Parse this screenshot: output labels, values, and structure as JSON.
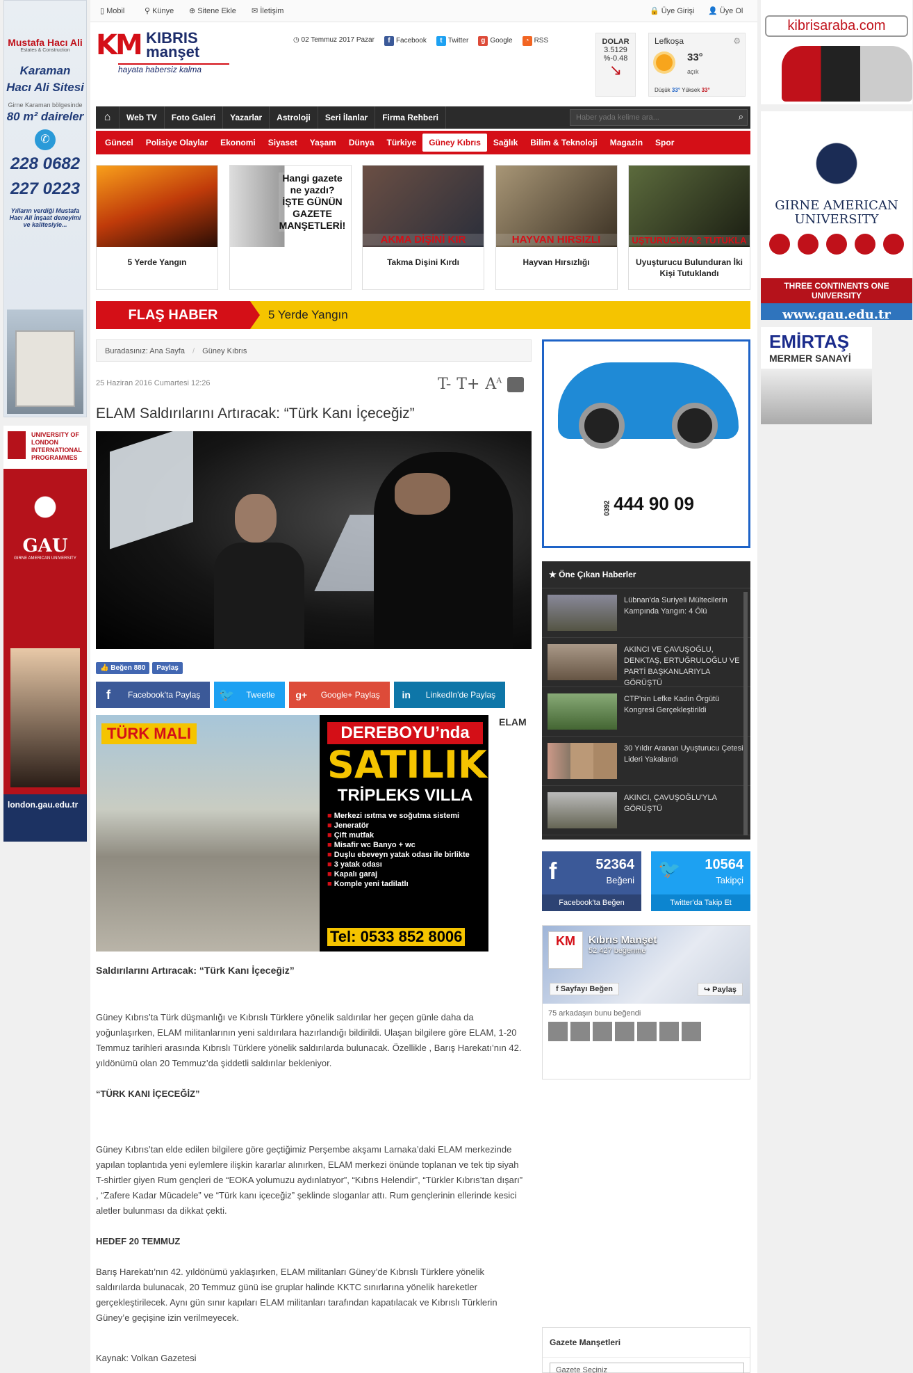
{
  "topbar": {
    "mobile": "Mobil",
    "kunye": "Künye",
    "add_site": "Sitene Ekle",
    "contact": "İletişim",
    "login": "Üye Girişi",
    "register": "Üye Ol"
  },
  "logo": {
    "km": "KM",
    "kibris": "KIBRIS",
    "manset": "manşet",
    "slogan": "hayata habersiz kalma"
  },
  "header": {
    "date": "02 Temmuz 2017 Pazar",
    "facebook": "Facebook",
    "twitter": "Twitter",
    "google": "Google",
    "rss": "RSS"
  },
  "dollar": {
    "label": "DOLAR",
    "value": "3.5129",
    "change": "%-0.48"
  },
  "weather": {
    "city": "Lefkoşa",
    "temp": "33°",
    "cond": "açık",
    "low_label": "Düşük",
    "low": "33°",
    "high_label": "Yüksek",
    "high": "33°"
  },
  "nav1": [
    "Web TV",
    "Foto Galeri",
    "Yazarlar",
    "Astroloji",
    "Seri İlanlar",
    "Firma Rehberi"
  ],
  "search_placeholder": "Haber yada kelime ara...",
  "nav2": [
    "Güncel",
    "Polisiye Olaylar",
    "Ekonomi",
    "Siyaset",
    "Yaşam",
    "Dünya",
    "Türkiye",
    "Güney Kıbrıs",
    "Sağlık",
    "Bilim & Teknoloji",
    "Magazin",
    "Spor"
  ],
  "cards": [
    {
      "title": "5 Yerde Yangın",
      "band": ""
    },
    {
      "title": "",
      "band": "Hangi gazete ne yazdı? İŞTE GÜNÜN GAZETE MANŞETLERİ!"
    },
    {
      "title": "Takma Dişini Kırdı",
      "band": "AKMA DİŞİNİ KIR"
    },
    {
      "title": "Hayvan Hırsızlığı",
      "band": "HAYVAN HIRSIZLI"
    },
    {
      "title": "Uyuşturucu Bulunduran İki Kişi Tutuklandı",
      "band": "UŞTURUCUYA 2 TUTUKLA"
    }
  ],
  "flash": {
    "label": "FLAŞ HABER",
    "text": "5 Yerde Yangın"
  },
  "breadcrumb": {
    "prefix": "Buradasınız:",
    "home": "Ana Sayfa",
    "current": "Güney Kıbrıs"
  },
  "article": {
    "date": "25 Haziran 2016 Cumartesi 12:26",
    "title": "ELAM Saldırılarını Artıracak: “Türk Kanı İçeceğiz”",
    "like_label": "Beğen",
    "like_count": "880",
    "share": "Paylaş",
    "elam": "ELAM",
    "subtitle": "Saldırılarını Artıracak: “Türk Kanı İçeceğiz”",
    "p1": "Güney Kıbrıs’ta Türk düşmanlığı ve Kıbrıslı Türklere yönelik saldırılar her geçen günle daha da yoğunlaşırken, ELAM militanlarının yeni saldırılara hazırlandığı bildirildi. Ulaşan bilgilere göre ELAM, 1-20 Temmuz tarihleri arasında Kıbrıslı Türklere yönelik saldırılarda bulunacak. Özellikle , Barış Harekatı’nın 42. yıldönümü olan 20 Temmuz’da şiddetli saldırılar bekleniyor.",
    "h1": "“TÜRK KANI İÇECEĞİZ”",
    "p2": "Güney Kıbrıs’tan elde edilen bilgilere göre geçtiğimiz Perşembe akşamı Larnaka’daki ELAM merkezinde yapılan toplantıda yeni eylemlere ilişkin kararlar alınırken, ELAM merkezi önünde toplanan ve tek tip siyah T-shirtler giyen Rum gençleri de “EOKA yolumuzu aydınlatıyor”, “Kıbrıs Helendir”, “Türkler Kıbrıs’tan dışarı” , “Zafere Kadar Mücadele” ve “Türk kanı içeceğiz” şeklinde sloganlar attı. Rum gençlerinin ellerinde kesici aletler bulunması da dikkat çekti.",
    "h2": "HEDEF 20 TEMMUZ",
    "p3": "Barış Harekatı’nın 42. yıldönümü yaklaşırken, ELAM militanları Güney’de Kıbrıslı Türklere yönelik saldırılarda bulunacak, 20 Temmuz günü ise gruplar halinde KKTC sınırlarına yönelik hareketler gerçekleştirilecek. Aynı gün sınır kapıları ELAM militanları tarafından kapatılacak ve Kıbrıslı Türklerin Güney’e geçişine izin verilmeyecek.",
    "source": "Kaynak: Volkan Gazetesi"
  },
  "share_buttons": {
    "facebook": "Facebook'ta Paylaş",
    "twitter": "Tweetle",
    "google": "Google+ Paylaş",
    "linkedin": "LinkedIn'de Paylaş"
  },
  "mid_ad": {
    "turk": "TÜRK MALI",
    "dereboyu": "DEREBOYU’nda",
    "satilik": "SATILIK",
    "tripleks": "TRİPLEKS VILLA",
    "features": [
      "Merkezi ısıtma ve soğutma sistemi",
      "Jeneratör",
      "Çift mutfak",
      "Misafir wc Banyo + wc",
      "Duşlu ebeveyn yatak odası ile birlikte",
      "3 yatak odası",
      "Kapalı garaj",
      "Komple yeni tadilatlı"
    ],
    "tel": "Tel: 0533 852 8006"
  },
  "side_ad": {
    "prefix": "0392",
    "phone": "444 90 09"
  },
  "one_cikan": {
    "title": "Öne Çıkan Haberler",
    "items": [
      "Lübnan'da Suriyeli Mültecilerin Kampında Yangın: 4 Ölü",
      "AKINCI VE ÇAVUŞOĞLU, DENKTAŞ, ERTUĞRULOĞLU VE PARTİ BAŞKANLARIYLA GÖRÜŞTÜ",
      "CTP'nin Lefke Kadın Örgütü Kongresi Gerçekleştirildi",
      "30 Yıldır Aranan Uyuşturucu Çetesi Lideri Yakalandı",
      "AKINCI, ÇAVUŞOĞLU'YLA GÖRÜŞTÜ"
    ]
  },
  "social": {
    "fb_count": "52364",
    "fb_label": "Beğeni",
    "fb_btn": "Facebook'ta Beğen",
    "tw_count": "10564",
    "tw_label": "Takipçi",
    "tw_btn": "Twitter'da Takip Et"
  },
  "fbpage": {
    "name": "Kıbrıs Manşet",
    "likes": "52.427 beğenme",
    "like_btn": "Sayfayı Beğen",
    "share_btn": "Paylaş",
    "friends": "75 arkadaşın bunu beğendi"
  },
  "gazete": {
    "title": "Gazete Manşetleri",
    "select": "Gazete Seçiniz"
  },
  "left_ad": {
    "brand": "Mustafa Hacı Ali",
    "brand_sub": "Estates & Construction",
    "line1": "Karaman",
    "line2": "Hacı Ali Sitesi",
    "small": "Girne Karaman bölgesinde",
    "area": "80 m² daireler",
    "phone1": "228 0682",
    "phone2": "227 0223",
    "tag": "Yılların verdiği Mustafa Hacı Ali İnşaat deneyimi ve kalitesiyle..."
  },
  "left_ad2": {
    "top": "UNIVERSITY OF LONDON INTERNATIONAL PROGRAMMES",
    "gau": "GAU",
    "gau_sub": "GIRNE AMERICAN UNIVERSITY",
    "url": "london.gau.edu.tr"
  },
  "right_ads": {
    "car_url": "kibrisaraba.com",
    "gau_name": "GIRNE AMERICAN UNIVERSITY",
    "gau_tag": "THREE CONTINENTS ONE UNIVERSITY",
    "gau_url": "www.gau.edu.tr",
    "emirtas": "EMİRTAŞ",
    "mermer": "MERMER SANAYİ"
  }
}
